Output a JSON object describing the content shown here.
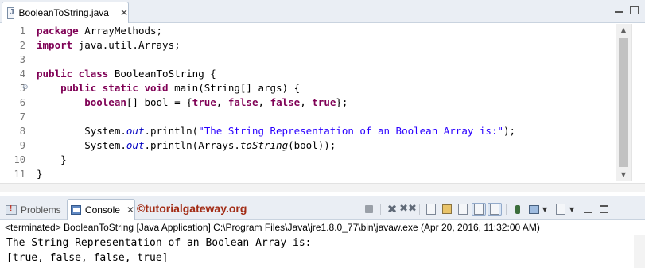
{
  "editor": {
    "tab_label": "BooleanToString.java",
    "close_glyph": "✕",
    "line_numbers": [
      "1",
      "2",
      "3",
      "4",
      "5",
      "6",
      "7",
      "8",
      "9",
      "10",
      "11"
    ],
    "code": {
      "l1_kw": "package",
      "l1_rest": " ArrayMethods;",
      "l2_kw": "import",
      "l2_rest": " java.util.Arrays;",
      "l4_kw": "public class",
      "l4_rest": " BooleanToString {",
      "l5_kw": "    public static void",
      "l5_rest": " main(String[] args) {",
      "l6_kw": "        boolean",
      "l6_mid": "[] bool = {",
      "l6_true1": "true",
      "l6_c1": ", ",
      "l6_false1": "false",
      "l6_c2": ", ",
      "l6_false2": "false",
      "l6_c3": ", ",
      "l6_true2": "true",
      "l6_end": "};",
      "l8_a": "        System.",
      "l8_out": "out",
      "l8_b": ".println(",
      "l8_str": "\"The String Representation of an Boolean Array is:\"",
      "l8_end": ");",
      "l9_a": "        System.",
      "l9_out": "out",
      "l9_b": ".println(Arrays.",
      "l9_method": "toString",
      "l9_end": "(bool));",
      "l10": "    }",
      "l11": "}"
    }
  },
  "console": {
    "tabs": {
      "problems": "Problems",
      "console": "Console"
    },
    "watermark": "©tutorialgateway.org",
    "status": "<terminated> BooleanToString [Java Application] C:\\Program Files\\Java\\jre1.8.0_77\\bin\\javaw.exe (Apr 20, 2016, 11:32:00 AM)",
    "output": "The String Representation of an Boolean Array is:\n[true, false, false, true]"
  },
  "colors": {
    "keyword": "#7f0055",
    "string": "#2a00ff",
    "field": "#0000c0",
    "watermark": "#a22b14"
  },
  "icons": {
    "editor_tab": "java-file-icon",
    "problems_tab": "problems-icon",
    "console_tab": "console-icon"
  }
}
